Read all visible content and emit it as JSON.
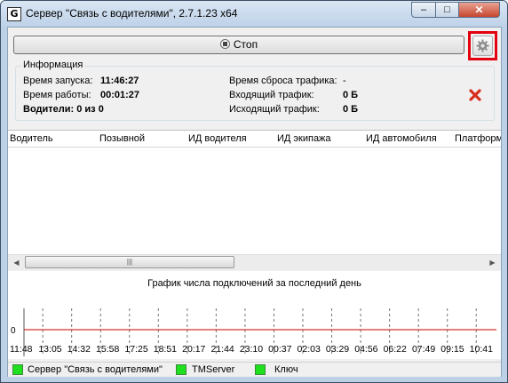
{
  "window": {
    "app_icon": "G",
    "title": "Сервер \"Связь с водителями\",  2.7.1.23 x64",
    "min_glyph": "–",
    "max_glyph": "□",
    "close_glyph": "✕"
  },
  "toolbar": {
    "stop_label": "Стоп",
    "stop_icon": "stop-icon",
    "settings_icon": "gear-icon"
  },
  "info": {
    "legend": "Информация",
    "start_time_label": "Время запуска:",
    "start_time_value": "11:46:27",
    "uptime_label": "Время работы:",
    "uptime_value": "00:01:27",
    "drivers_label": "Водители: 0 из 0",
    "traffic_reset_label": "Время сброса трафика:",
    "traffic_reset_value": "-",
    "incoming_label": "Входящий трафик:",
    "incoming_value": "0 Б",
    "outgoing_label": "Исходящий трафик:",
    "outgoing_value": "0 Б"
  },
  "table": {
    "columns": [
      "Водитель",
      "Позывной",
      "ИД водителя",
      "ИД экипажа",
      "ИД автомобиля",
      "Платформ"
    ],
    "rows": [],
    "scroll_thumb_glyph": "|||",
    "left_arrow": "◀",
    "right_arrow": "▶"
  },
  "chart_data": {
    "type": "line",
    "title": "График числа подключений за последний день",
    "x": [
      "11:48",
      "13:05",
      "14:32",
      "15:58",
      "17:25",
      "18:51",
      "20:17",
      "21:44",
      "23:10",
      "00:37",
      "02:03",
      "03:29",
      "04:56",
      "06:22",
      "07:49",
      "09:15",
      "10:41"
    ],
    "series": [
      {
        "values": [
          0,
          0,
          0,
          0,
          0,
          0,
          0,
          0,
          0,
          0,
          0,
          0,
          0,
          0,
          0,
          0,
          0
        ]
      }
    ],
    "yticks": [
      "0"
    ],
    "ylim": [
      -1,
      1
    ],
    "grid": "vertical dashed",
    "line_color": "#cc0000"
  },
  "status": {
    "items": [
      {
        "label": "Сервер \"Связь с водителями\"",
        "state_color": "#1fe01f"
      },
      {
        "label": "TMServer",
        "state_color": "#1fe01f"
      },
      {
        "label": "Ключ",
        "state_color": "#1fe01f"
      }
    ]
  }
}
